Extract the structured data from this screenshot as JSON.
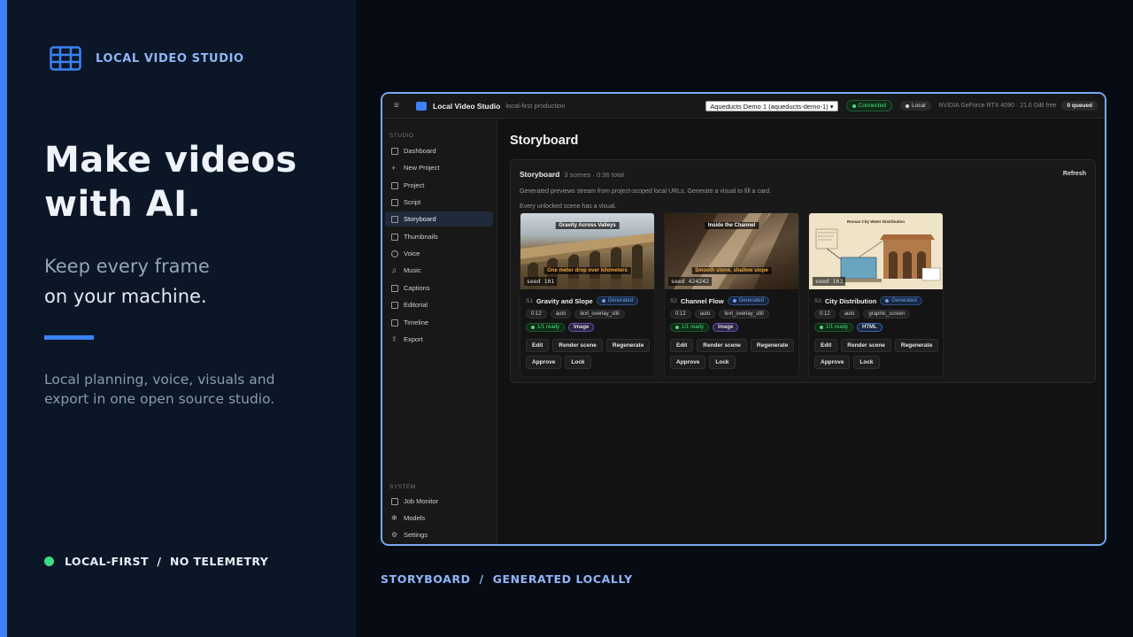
{
  "brand": {
    "name": "LOCAL VIDEO STUDIO",
    "icon": "film-grid-icon"
  },
  "hero": {
    "line1": "Make videos",
    "line2": "with AI."
  },
  "sub": {
    "line1": "Keep every frame",
    "line2": "on your machine."
  },
  "desc": "Local planning, voice, visuals and export in one open source studio.",
  "footer": {
    "label": "LOCAL-FIRST  /  NO TELEMETRY",
    "dot_color": "#3ddc84"
  },
  "caption": "STORYBOARD  /  GENERATED LOCALLY",
  "colors": {
    "accent": "#3b82f6",
    "left_panel": "#0b1626",
    "page": "#070c14"
  },
  "app": {
    "title": "Local Video Studio",
    "tagline": "local-first production",
    "project_select": "Aqueducts Demo 1 (aqueducts-demo-1)",
    "status_connected": "Connected",
    "status_local": "Local",
    "gpu": "NVIDIA GeForce RTX 4090 · 21.6 GiB free",
    "queue": "0 queued",
    "sidebar": {
      "studio_heading": "STUDIO",
      "items": [
        {
          "label": "Dashboard",
          "icon": "dashboard-icon"
        },
        {
          "label": "New Project",
          "icon": "plus-icon"
        },
        {
          "label": "Project",
          "icon": "folder-icon"
        },
        {
          "label": "Script",
          "icon": "document-icon"
        },
        {
          "label": "Storyboard",
          "icon": "storyboard-icon"
        },
        {
          "label": "Thumbnails",
          "icon": "image-icon"
        },
        {
          "label": "Voice",
          "icon": "microphone-icon"
        },
        {
          "label": "Music",
          "icon": "music-icon"
        },
        {
          "label": "Captions",
          "icon": "captions-icon"
        },
        {
          "label": "Editorial",
          "icon": "editorial-icon"
        },
        {
          "label": "Timeline",
          "icon": "timeline-icon"
        },
        {
          "label": "Export",
          "icon": "export-icon"
        }
      ],
      "active": "Storyboard",
      "system_heading": "SYSTEM",
      "system_items": [
        {
          "label": "Job Monitor",
          "icon": "monitor-icon"
        },
        {
          "label": "Models",
          "icon": "models-icon"
        },
        {
          "label": "Settings",
          "icon": "gear-icon"
        }
      ]
    },
    "page_title": "Storyboard",
    "panel": {
      "title": "Storyboard",
      "meta": "3 scenes · 0:36 total",
      "refresh": "Refresh",
      "note1": "Generated previews stream from project-scoped local URLs. Generate a visual to fill a card.",
      "note2": "Every unlocked scene has a visual."
    },
    "scenes": [
      {
        "num": "S1",
        "title": "Gravity and Slope",
        "status": "Generated",
        "duration": "0:12",
        "mode": "auto",
        "layout": "text_overlay_still",
        "ready": "1/1 ready",
        "kind": "Image",
        "seed": "seed 101",
        "thumb_title": "Gravity Across Valleys",
        "thumb_subtitle": "One meter drop over kilometers",
        "buttons": [
          "Edit",
          "Render scene",
          "Regenerate",
          "Approve",
          "Lock"
        ]
      },
      {
        "num": "S2",
        "title": "Channel Flow",
        "status": "Generated",
        "duration": "0:12",
        "mode": "auto",
        "layout": "text_overlay_still",
        "ready": "1/1 ready",
        "kind": "Image",
        "seed": "seed 424242",
        "thumb_title": "Inside the Channel",
        "thumb_subtitle": "Smooth stone, shallow slope",
        "buttons": [
          "Edit",
          "Render scene",
          "Regenerate",
          "Approve",
          "Lock"
        ]
      },
      {
        "num": "S3",
        "title": "City Distribution",
        "status": "Generated",
        "duration": "0:12",
        "mode": "auto",
        "layout": "graphic_screen",
        "ready": "1/1 ready",
        "kind": "HTML",
        "seed": "seed 103",
        "thumb_title": "Roman City Water Distribution",
        "buttons": [
          "Edit",
          "Render scene",
          "Regenerate",
          "Approve",
          "Lock"
        ]
      }
    ]
  }
}
